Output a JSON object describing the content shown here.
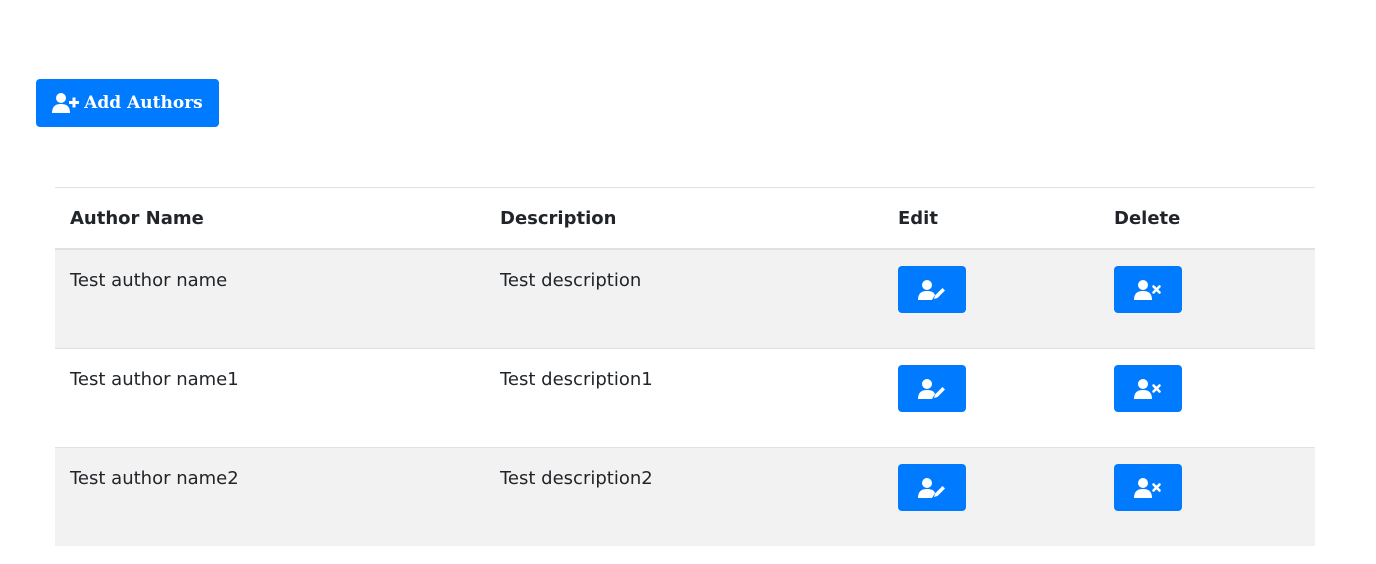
{
  "toolbar": {
    "add_label": "Add Authors",
    "add_icon": "user-plus-icon"
  },
  "table": {
    "headers": {
      "name": "Author Name",
      "description": "Description",
      "edit": "Edit",
      "delete": "Delete"
    },
    "rows": [
      {
        "name": "Test author name",
        "description": "Test description"
      },
      {
        "name": "Test author name1",
        "description": "Test description1"
      },
      {
        "name": "Test author name2",
        "description": "Test description2"
      }
    ],
    "edit_icon": "user-edit-icon",
    "delete_icon": "user-times-icon"
  },
  "colors": {
    "primary": "#007bff",
    "stripe": "#f2f2f2",
    "border": "#dee2e6"
  }
}
